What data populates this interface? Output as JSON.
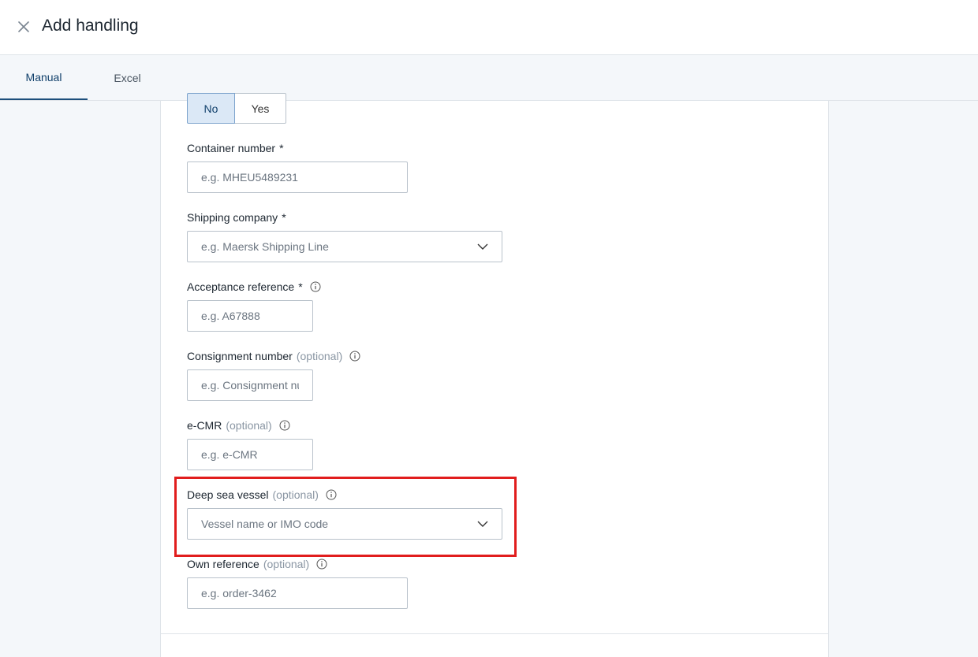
{
  "header": {
    "title": "Add handling",
    "close_icon": "close-icon"
  },
  "tabs": [
    {
      "label": "Manual",
      "active": true
    },
    {
      "label": "Excel",
      "active": false
    }
  ],
  "toggle": {
    "no_label": "No",
    "yes_label": "Yes",
    "selected": "No"
  },
  "form": {
    "container_number": {
      "label": "Container number",
      "required": "*",
      "placeholder": "e.g. MHEU5489231"
    },
    "shipping_company": {
      "label": "Shipping company",
      "required": "*",
      "placeholder": "e.g. Maersk Shipping Line"
    },
    "acceptance_reference": {
      "label": "Acceptance reference",
      "required": "*",
      "placeholder": "e.g. A67888"
    },
    "consignment_number": {
      "label": "Consignment number",
      "optional": "(optional)",
      "placeholder": "e.g. Consignment number"
    },
    "ecmr": {
      "label": "e-CMR",
      "optional": "(optional)",
      "placeholder": "e.g. e-CMR"
    },
    "deep_sea_vessel": {
      "label": "Deep sea vessel",
      "optional": "(optional)",
      "placeholder": "Vessel name or IMO code"
    },
    "own_reference": {
      "label": "Own reference",
      "optional": "(optional)",
      "placeholder": "e.g. order-3462"
    }
  },
  "colors": {
    "accent": "#11406b",
    "highlight": "#e11d1d"
  }
}
